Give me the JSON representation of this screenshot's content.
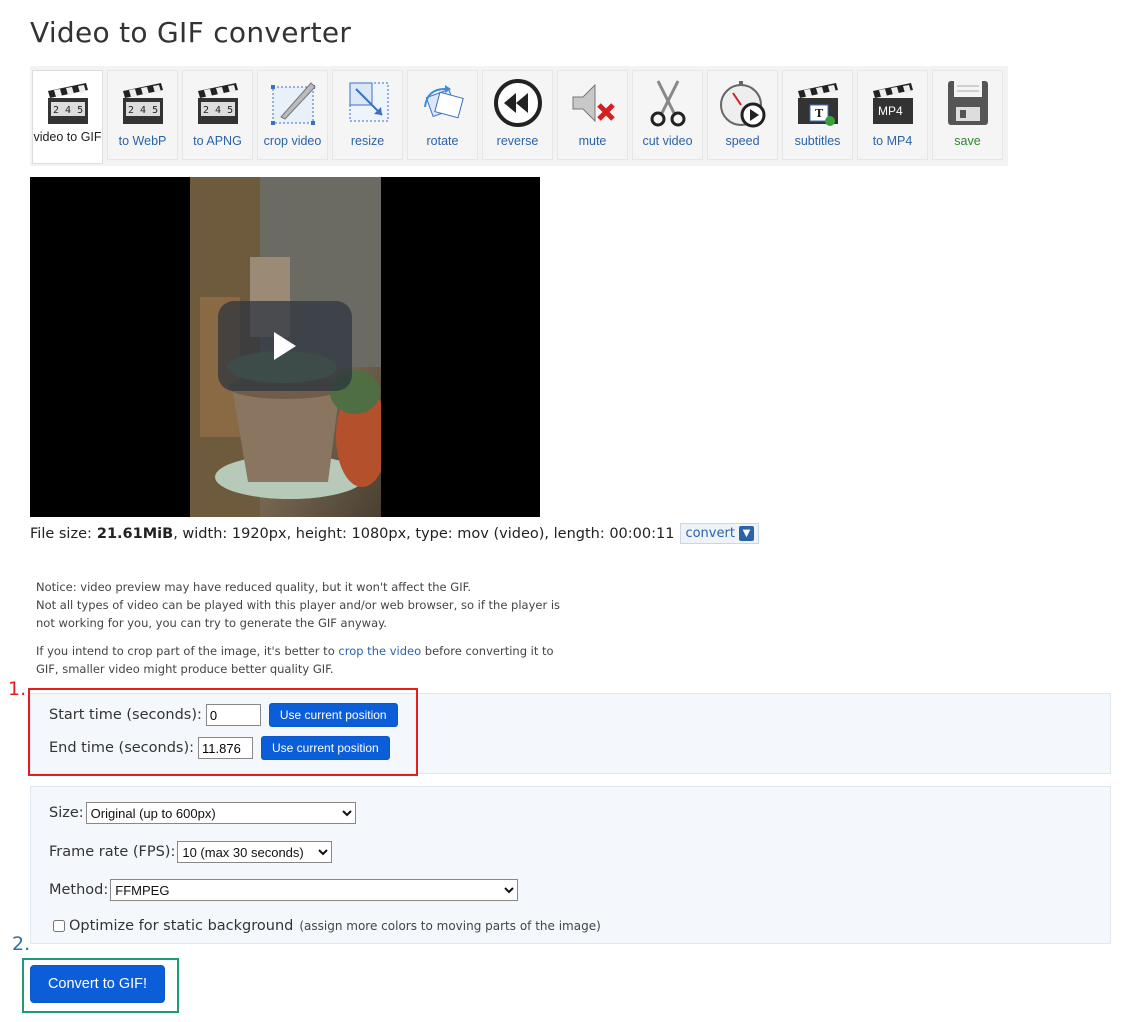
{
  "page": {
    "title": "Video to GIF converter"
  },
  "toolbar": {
    "items": [
      {
        "id": "video-to-gif",
        "label": "video to GIF",
        "icon": "clapperboard-icon",
        "active": true
      },
      {
        "id": "to-webp",
        "label": "to WebP",
        "icon": "clapperboard-icon"
      },
      {
        "id": "to-apng",
        "label": "to APNG",
        "icon": "clapperboard-icon"
      },
      {
        "id": "crop-video",
        "label": "crop video",
        "icon": "crop-icon"
      },
      {
        "id": "resize",
        "label": "resize",
        "icon": "resize-icon"
      },
      {
        "id": "rotate",
        "label": "rotate",
        "icon": "rotate-icon"
      },
      {
        "id": "reverse",
        "label": "reverse",
        "icon": "rewind-icon"
      },
      {
        "id": "mute",
        "label": "mute",
        "icon": "mute-icon"
      },
      {
        "id": "cut-video",
        "label": "cut video",
        "icon": "scissors-icon"
      },
      {
        "id": "speed",
        "label": "speed",
        "icon": "stopwatch-icon"
      },
      {
        "id": "subtitles",
        "label": "subtitles",
        "icon": "subtitles-icon"
      },
      {
        "id": "to-mp4",
        "label": "to MP4",
        "icon": "mp4-icon",
        "badge": "MP4"
      },
      {
        "id": "save",
        "label": "save",
        "icon": "floppy-disk-icon"
      }
    ]
  },
  "file_info": {
    "size_label": "File size:",
    "size_value": "21.61MiB",
    "details": ", width: 1920px, height: 1080px, type: mov (video), length: 00:00:11",
    "convert_label": "convert"
  },
  "notices": {
    "line1": "Notice: video preview may have reduced quality, but it won't affect the GIF.",
    "line2": "Not all types of video can be played with this player and/or web browser, so if the player is not working for you, you can try to generate the GIF anyway.",
    "line3_prefix": "If you intend to crop part of the image, it's better to ",
    "line3_link": "crop the video",
    "line3_suffix": " before converting it to GIF, smaller video might produce better quality GIF."
  },
  "time_panel": {
    "start_label": "Start time (seconds):",
    "start_value": "0",
    "end_label": "End time (seconds):",
    "end_value": "11.876",
    "use_current_label": "Use current position"
  },
  "options_panel": {
    "size_label": "Size:",
    "size_value": "Original (up to 600px)",
    "fps_label": "Frame rate (FPS):",
    "fps_value": "10 (max 30 seconds)",
    "method_label": "Method:",
    "method_value": "FFMPEG",
    "optimize_label": "Optimize for static background",
    "optimize_hint": "(assign more colors to moving parts of the image)"
  },
  "annotations": {
    "step1": "1.",
    "step2": "2."
  },
  "actions": {
    "convert_button": "Convert to GIF!"
  },
  "colors": {
    "accent": "#0b5ed7",
    "link": "#2b63a8",
    "annotation_red": "#e02020",
    "annotation_green": "#1f9a78",
    "panel_bg": "#f4f8fc"
  }
}
